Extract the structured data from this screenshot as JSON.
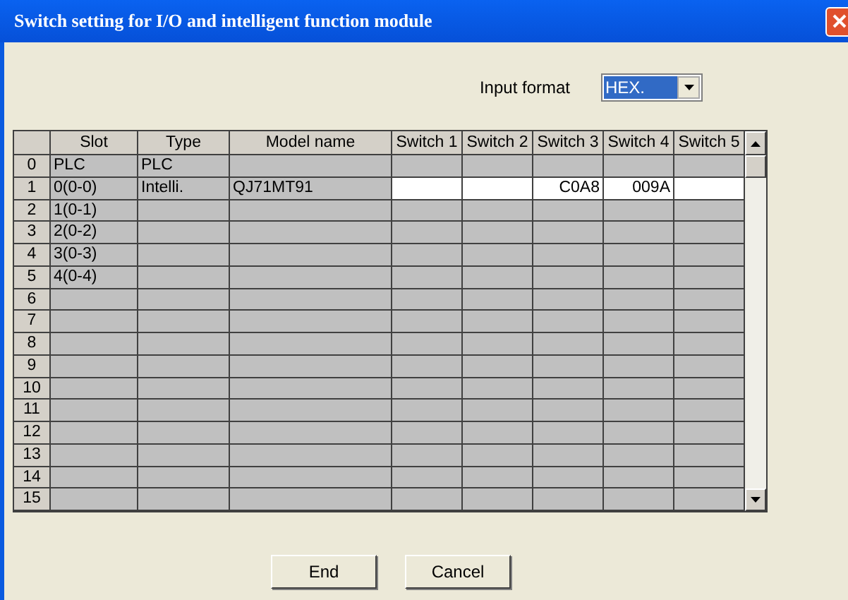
{
  "window": {
    "title": "Switch setting for I/O and intelligent function module"
  },
  "input_format": {
    "label": "Input format",
    "value": "HEX."
  },
  "table": {
    "columns": [
      "Slot",
      "Type",
      "Model name",
      "Switch 1",
      "Switch 2",
      "Switch 3",
      "Switch 4",
      "Switch 5"
    ],
    "rows": [
      {
        "number": "0",
        "slot": "PLC",
        "type": "PLC",
        "editable": false
      },
      {
        "number": "1",
        "slot": "0(0-0)",
        "type": "Intelli.",
        "model": "QJ71MT91",
        "editable": true,
        "switches": {
          "3": "C0A8",
          "4": "009A"
        }
      },
      {
        "number": "2",
        "slot": "1(0-1)",
        "editable": false
      },
      {
        "number": "3",
        "slot": "2(0-2)",
        "editable": false
      },
      {
        "number": "4",
        "slot": "3(0-3)",
        "editable": false
      },
      {
        "number": "5",
        "slot": "4(0-4)",
        "editable": false
      },
      {
        "number": "6",
        "editable": false
      },
      {
        "number": "7",
        "editable": false
      },
      {
        "number": "8",
        "editable": false
      },
      {
        "number": "9",
        "editable": false
      },
      {
        "number": "10",
        "editable": false
      },
      {
        "number": "11",
        "editable": false
      },
      {
        "number": "12",
        "editable": false
      },
      {
        "number": "13",
        "editable": false
      },
      {
        "number": "14",
        "editable": false
      },
      {
        "number": "15",
        "editable": false
      }
    ]
  },
  "buttons": [
    "End",
    "Cancel"
  ]
}
